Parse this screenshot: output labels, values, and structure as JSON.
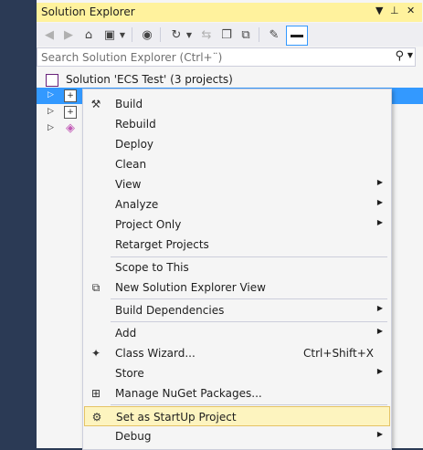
{
  "window": {
    "title": "Solution Explorer"
  },
  "titlebar_controls": [
    "▼",
    "⊥",
    "✕"
  ],
  "search": {
    "placeholder": "Search Solution Explorer (Ctrl+¨)"
  },
  "tree": {
    "solution": {
      "label": "Solution 'ECS Test' (3 projects)"
    },
    "projects": [
      {
        "selected": true
      },
      {
        "selected": false
      },
      {
        "selected": false
      }
    ]
  },
  "context_menu": {
    "items": [
      {
        "label": "Build",
        "icon": "build-icon"
      },
      {
        "label": "Rebuild"
      },
      {
        "label": "Deploy"
      },
      {
        "label": "Clean"
      },
      {
        "label": "View",
        "submenu": true
      },
      {
        "label": "Analyze",
        "submenu": true
      },
      {
        "label": "Project Only",
        "submenu": true
      },
      {
        "label": "Retarget Projects"
      },
      {
        "label": "Scope to This"
      },
      {
        "label": "New Solution Explorer View",
        "icon": "new-view-icon"
      },
      {
        "label": "Build Dependencies",
        "submenu": true
      },
      {
        "label": "Add",
        "submenu": true
      },
      {
        "label": "Class Wizard...",
        "shortcut": "Ctrl+Shift+X",
        "icon": "class-wizard-icon"
      },
      {
        "label": "Store",
        "submenu": true
      },
      {
        "label": "Manage NuGet Packages...",
        "icon": "nuget-icon"
      },
      {
        "label": "Set as StartUp Project",
        "icon": "gear-icon",
        "highlighted": true
      },
      {
        "label": "Debug",
        "submenu": true
      }
    ]
  },
  "colors": {
    "title_bg": "#fff29d",
    "selection": "#3399ff",
    "menu_highlight": "#fdf4bf"
  }
}
